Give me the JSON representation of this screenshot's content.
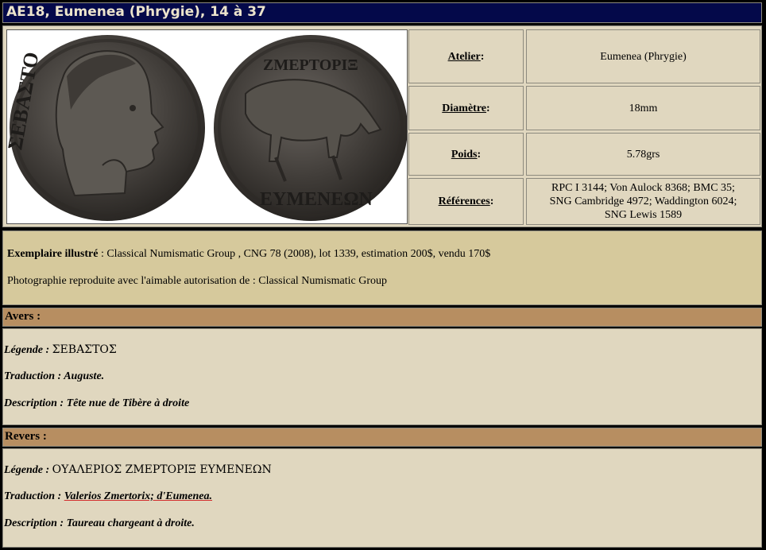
{
  "title": "AE18, Eumenea (Phrygie), 14 à 37",
  "images": {
    "obverse_legend_fragment": "ΣΕΒΑΣΤΟ",
    "reverse_legend_top_fragment": "ΖΜΕΡΤΟΡΙΞ",
    "reverse_legend_bottom_fragment": "ΕΥΜΕΝΕΩΝ"
  },
  "info": [
    {
      "label": "Atelier",
      "sep": " :",
      "value": "Eumenea (Phrygie)"
    },
    {
      "label": "Diamètre",
      "sep": " :",
      "value": "18mm"
    },
    {
      "label": "Poids",
      "sep": " :",
      "value": "5.78grs"
    },
    {
      "label": "Références",
      "sep": " :",
      "value_lines": [
        "RPC I 3144; Von Aulock 8368; BMC 35;",
        "SNG Cambridge 4972; Waddington 6024;",
        "SNG Lewis 1589"
      ]
    }
  ],
  "credit": {
    "exemplaire_label": "Exemplaire illustré",
    "exemplaire_text": " : Classical Numismatic Group , CNG 78 (2008), lot 1339, estimation 200$, vendu 170$",
    "photo_text": "Photographie reproduite avec l'aimable autorisation de : Classical Numismatic Group"
  },
  "avers": {
    "header": "Avers :",
    "legende_label": "Légende : ",
    "legende_value": "ΣΕΒΑΣΤΟΣ",
    "traduction_label": "Traduction : ",
    "traduction_value": "Auguste.",
    "description_label": "Description : ",
    "description_value": "Tête nue de Tibère à droite"
  },
  "revers": {
    "header": "Revers :",
    "legende_label": "Légende : ",
    "legende_value": "ΟΥΑΛΕΡΙΟΣ ΖΜΕΡΤΟΡΙΞ ΕΥΜΕΝΕΩΝ",
    "traduction_label": "Traduction : ",
    "traduction_value": "Valerios Zmertorix; d'Eumenea.",
    "description_label": "Description : ",
    "description_value": "Taureau chargeant à droite."
  },
  "colors": {
    "title_bg": "#04094a",
    "title_text": "#ece4cc",
    "panel_bg": "#e0d7bf",
    "credit_bg": "#d6c99c",
    "section_header_bg": "#b78e61"
  }
}
